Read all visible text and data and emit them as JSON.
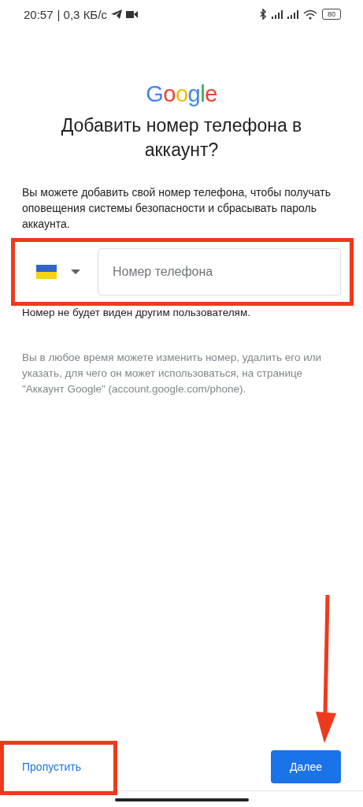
{
  "status_bar": {
    "time": "20:57",
    "speed": "| 0,3 КБ/с",
    "battery": "80"
  },
  "logo": "Google",
  "title": "Добавить номер телефона в аккаунт?",
  "intro": "Вы можете добавить свой номер телефона, чтобы получать оповещения системы безопасности и сбрасывать пароль аккаунта.",
  "phone_field": {
    "placeholder": "Номер телефона"
  },
  "note": "Номер не будет виден другим пользователям.",
  "info": "Вы в любое время можете изменить номер, удалить его или указать, для чего он может использоваться, на странице \"Аккаунт Google\" (account.google.com/phone).",
  "buttons": [
    {
      "kind": "text",
      "label": "Пропустить"
    },
    {
      "kind": "filled",
      "label": "Далее"
    }
  ]
}
